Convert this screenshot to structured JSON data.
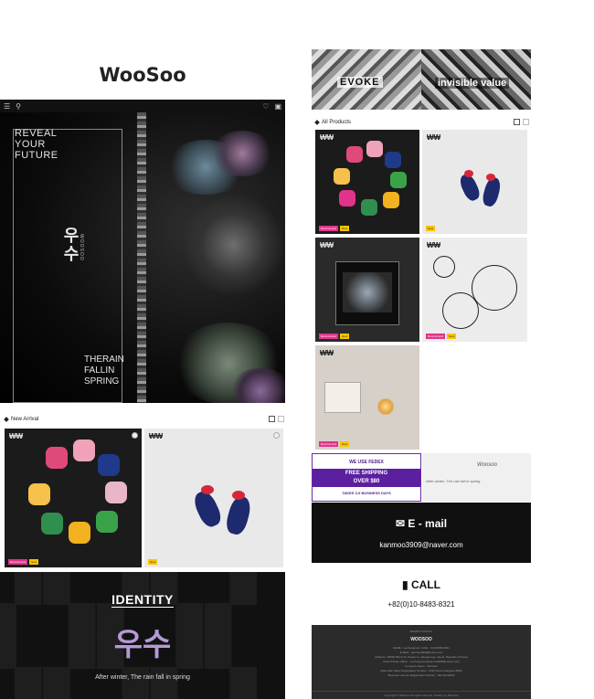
{
  "header": {
    "logo": "WooSoo"
  },
  "left": {
    "topbar": {
      "menu_icon": "menu-icon",
      "search_icon": "search-icon",
      "heart_icon": "heart-icon",
      "cart_icon": "cart-icon"
    },
    "hero": {
      "reveal": [
        "REVEAL",
        "YOUR",
        "FUTURE"
      ],
      "brand_ko": "우수",
      "brand_sub": "WOOSOO",
      "therain": [
        "THERAIN",
        "FALLIN",
        "SPRING"
      ]
    },
    "new_arrival": {
      "title": "New Arrival",
      "products": [
        {
          "badge": "₩₩",
          "tags": [
            "Recommend",
            "New"
          ]
        },
        {
          "badge": "₩₩",
          "tags": [
            "New"
          ]
        }
      ]
    },
    "identity": {
      "title": "IDENTITY",
      "brand_ko": "우수",
      "subtitle": "After winter, The rain fall in spring"
    }
  },
  "right": {
    "banner": {
      "left": "EVOKE",
      "right": "invisible value"
    },
    "all_products": {
      "title": "All Products",
      "products": [
        {
          "badge": "₩₩",
          "tags": [
            "Recommend",
            "New"
          ]
        },
        {
          "badge": "₩₩",
          "tags": [
            "New"
          ]
        },
        {
          "badge": "₩₩",
          "tags": [
            "Recommend",
            "New"
          ]
        },
        {
          "badge": "₩₩",
          "tags": [
            "Recommend",
            "New"
          ]
        },
        {
          "badge": "₩₩",
          "tags": [
            "Recommend",
            "New"
          ]
        }
      ]
    },
    "promo": {
      "line1": "WE USE FEDEX",
      "band1": "FREE SHIPPING",
      "band2": "OVER $80",
      "line3": "TAKES 3-5 BUSINESS DAYS",
      "woo_name": "Woosoo",
      "woo_text": "After winter, The rain fall in spring"
    },
    "email": {
      "label": "E - mail",
      "value": "kanmoo3909@naver.com"
    },
    "call": {
      "label": "CALL",
      "value": "+82(0)10-8483-8321"
    },
    "footer": {
      "privacy": "PRIVACY POLICY",
      "brand": "WOOSOO",
      "info": [
        "NAME : LeeSungmoo  |  CALL : 010-8483-8321",
        "E-MAIL : kanmoo3909@naver.com",
        "Address : 06000 RM 2-12, Gimpo-ro, Gangseo-gu, Seoul, Republic of Korea",
        "Chief Privacy Officer : LeeSungmoo(kanmoo3909@naver.com)",
        "Company Name : WooSoo",
        "Mail-order Sales Registration Number : 2020-Seoul-Gangseo-0000",
        "Business License Registration Number : 000-00-00000"
      ],
      "copyright": "Copyright © WooSoo All rights reserved. Hosting by PlayAuto"
    }
  }
}
